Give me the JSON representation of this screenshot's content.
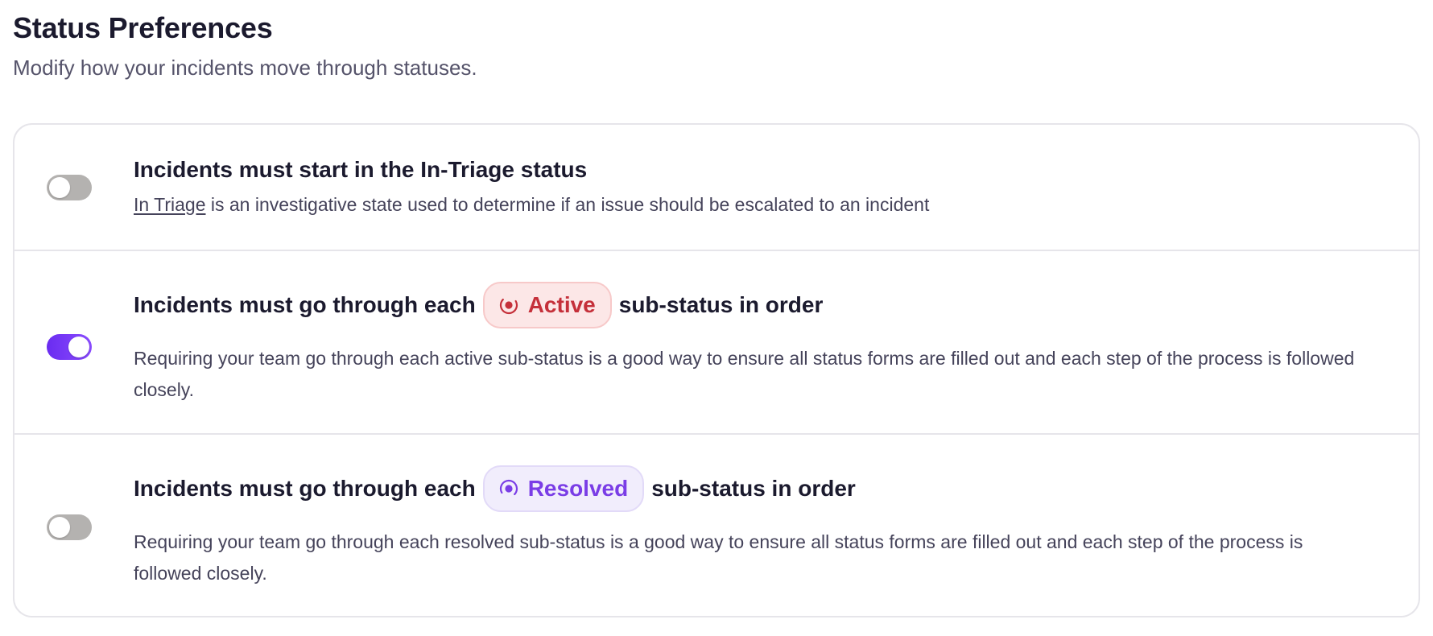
{
  "header": {
    "title": "Status Preferences",
    "subtitle": "Modify how your incidents move through statuses."
  },
  "preferences": [
    {
      "enabled": false,
      "title": "Incidents must start in the In-Triage status",
      "description_link": "In Triage",
      "description": " is an investigative state used to determine if an issue should be escalated to an incident"
    },
    {
      "enabled": true,
      "title_prefix": "Incidents must go through each",
      "badge_label": "Active",
      "badge_icon": "active-status-icon",
      "badge_color": "#c5303a",
      "title_suffix": "sub-status in order",
      "description": "Requiring your team go through each active sub-status is a good way to ensure all status forms are filled out and each step of the process is followed closely."
    },
    {
      "enabled": false,
      "title_prefix": "Incidents must go through each",
      "badge_label": "Resolved",
      "badge_icon": "resolved-status-icon",
      "badge_color": "#7a3de6",
      "title_suffix": "sub-status in order",
      "description": "Requiring your team go through each resolved sub-status is a good way to ensure all status forms are filled out and each step of the process is followed closely."
    }
  ],
  "colors": {
    "toggle_on": "#7b3cf5",
    "toggle_off": "#b4b2b0",
    "active": "#c5303a",
    "resolved": "#7a3de6"
  }
}
